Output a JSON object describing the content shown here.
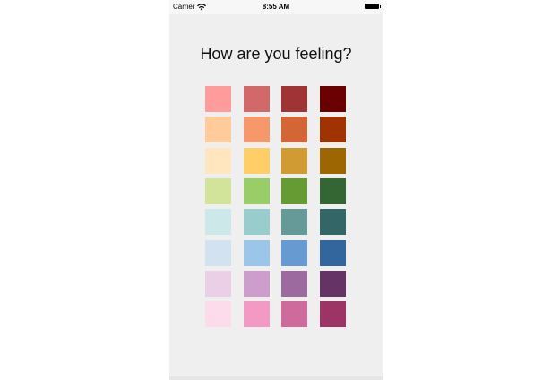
{
  "status_bar": {
    "carrier": "Carrier",
    "time": "8:55 AM",
    "wifi_icon": "wifi-icon",
    "battery_icon": "battery-icon"
  },
  "title": "How are you feeling?",
  "colors": [
    [
      "#ff9b9b",
      "#d36868",
      "#a03434",
      "#6a0000"
    ],
    [
      "#ffcc99",
      "#f6986a",
      "#d36634",
      "#a03300"
    ],
    [
      "#ffe6bf",
      "#ffce67",
      "#d19b33",
      "#9e6600"
    ],
    [
      "#d2e49a",
      "#99cd68",
      "#669a33",
      "#336633"
    ],
    [
      "#cde8e8",
      "#99cccd",
      "#669a99",
      "#336767"
    ],
    [
      "#d2e2f1",
      "#9cc6e9",
      "#669ad0",
      "#33669d"
    ],
    [
      "#ebcfe6",
      "#cd9dcc",
      "#9c6a9e",
      "#663367"
    ],
    [
      "#fcdbea",
      "#f399c3",
      "#cf6a9c",
      "#9c3466"
    ]
  ]
}
